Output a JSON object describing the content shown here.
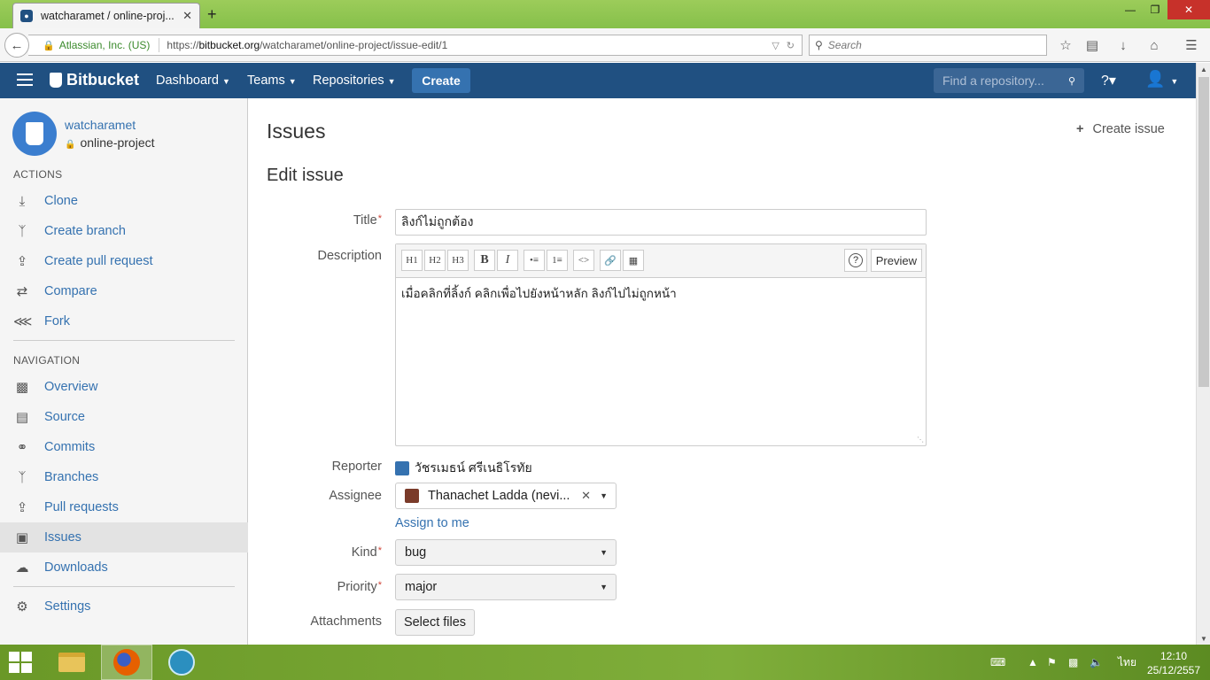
{
  "browser": {
    "tab_title": "watcharamet / online-proj...",
    "identity": "Atlassian, Inc. (US)",
    "url_prefix": "https://",
    "url_host": "bitbucket.org",
    "url_path": "/watcharamet/online-project/issue-edit/1",
    "search_placeholder": "Search"
  },
  "header": {
    "logo": "Bitbucket",
    "menus": [
      "Dashboard",
      "Teams",
      "Repositories"
    ],
    "create": "Create",
    "repo_search_placeholder": "Find a repository..."
  },
  "sidebar": {
    "owner": "watcharamet",
    "repo": "online-project",
    "actions_heading": "ACTIONS",
    "actions": [
      "Clone",
      "Create branch",
      "Create pull request",
      "Compare",
      "Fork"
    ],
    "navigation_heading": "NAVIGATION",
    "navigation": [
      "Overview",
      "Source",
      "Commits",
      "Branches",
      "Pull requests",
      "Issues",
      "Downloads"
    ],
    "settings": "Settings",
    "active": "Issues"
  },
  "main": {
    "title": "Issues",
    "create_issue": "Create issue",
    "subtitle": "Edit issue",
    "labels": {
      "title": "Title",
      "description": "Description",
      "reporter": "Reporter",
      "assignee": "Assignee",
      "kind": "Kind",
      "priority": "Priority",
      "attachments": "Attachments"
    },
    "title_value": "ลิงก์ไม่ถูกต้อง",
    "toolbar": [
      "H1",
      "H2",
      "H3",
      "B",
      "I"
    ],
    "preview": "Preview",
    "description_value": "เมื่อคลิกที่ลิ้งก์ คลิกเพื่อไปยังหน้าหลัก ลิงก์ไปไม่ถูกหน้า",
    "reporter_value": "วัชรเมธน์ ศรีเนธิโรทัย",
    "assignee_value": "Thanachet Ladda (nevi...",
    "assign_to_me": "Assign to me",
    "kind_value": "bug",
    "priority_value": "major",
    "select_files": "Select files"
  },
  "taskbar": {
    "lang": "ไทย",
    "time": "12:10",
    "date": "25/12/2557"
  }
}
